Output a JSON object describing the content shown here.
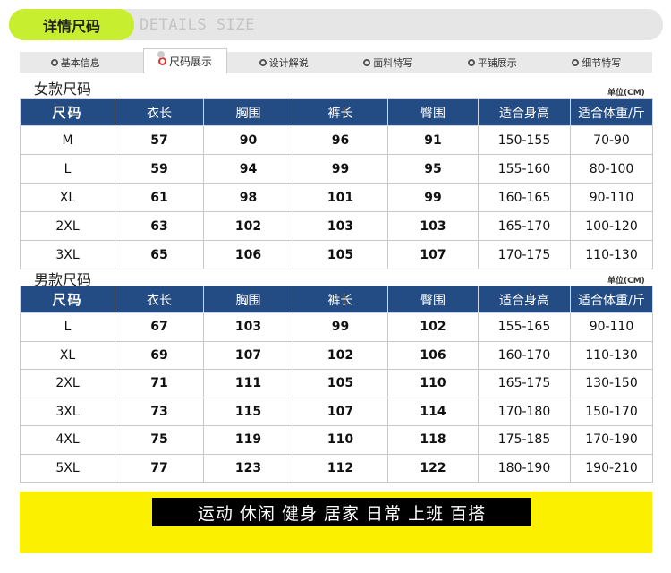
{
  "header": {
    "title": "详情尺码",
    "subtitle": "DETAILS SIZE"
  },
  "tabs": {
    "basic_info": "基本信息",
    "size_display": "尺码展示",
    "design": "设计解说",
    "fabric": "面料特写",
    "flat": "平铺展示",
    "detail": "细节特写"
  },
  "women": {
    "title": "女款尺码",
    "unit": "单位(CM)",
    "headers": [
      "尺码",
      "衣长",
      "胸围",
      "裤长",
      "臀围",
      "适合身高",
      "适合体重/斤"
    ],
    "rows": [
      [
        "M",
        "57",
        "90",
        "96",
        "91",
        "150-155",
        "70-90"
      ],
      [
        "L",
        "59",
        "94",
        "99",
        "95",
        "155-160",
        "80-100"
      ],
      [
        "XL",
        "61",
        "98",
        "101",
        "99",
        "160-165",
        "90-110"
      ],
      [
        "2XL",
        "63",
        "102",
        "103",
        "103",
        "165-170",
        "100-120"
      ],
      [
        "3XL",
        "65",
        "106",
        "105",
        "107",
        "170-175",
        "110-130"
      ]
    ]
  },
  "men": {
    "title": "男款尺码",
    "unit": "单位(CM)",
    "headers": [
      "尺码",
      "衣长",
      "胸围",
      "裤长",
      "臀围",
      "适合身高",
      "适合体重/斤"
    ],
    "rows": [
      [
        "L",
        "67",
        "103",
        "99",
        "102",
        "155-165",
        "90-110"
      ],
      [
        "XL",
        "69",
        "107",
        "102",
        "106",
        "160-170",
        "110-130"
      ],
      [
        "2XL",
        "71",
        "111",
        "105",
        "110",
        "165-175",
        "130-150"
      ],
      [
        "3XL",
        "73",
        "115",
        "107",
        "114",
        "170-180",
        "150-170"
      ],
      [
        "4XL",
        "75",
        "119",
        "110",
        "118",
        "175-185",
        "170-190"
      ],
      [
        "5XL",
        "77",
        "123",
        "112",
        "122",
        "180-190",
        "190-210"
      ]
    ]
  },
  "footer": {
    "label": "运动 休闲 健身 居家 日常 上班 百搭"
  },
  "colors": {
    "header_accent": "#c7ef2f",
    "table_header": "#244c84",
    "footer_bg": "#faf000"
  }
}
